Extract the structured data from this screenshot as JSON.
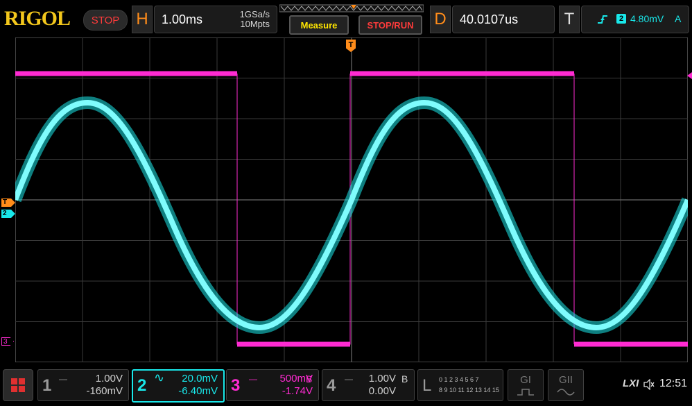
{
  "topbar": {
    "brand": "RIGOL",
    "run_state": "STOP",
    "horizontal": {
      "letter": "H",
      "timebase": "1.00ms",
      "sample_rate": "1GSa/s",
      "memory_depth": "10Mpts"
    },
    "measure_label": "Measure",
    "stoprun_label": "STOP/RUN",
    "delay": {
      "letter": "D",
      "value": "40.0107us"
    },
    "trigger": {
      "letter": "T",
      "source": "2",
      "level": "4.80mV",
      "mode": "A"
    }
  },
  "markers": {
    "trigger_top": "T",
    "trigger_left": "T",
    "ch2_left": "2",
    "ch3_left": "3"
  },
  "channels": [
    {
      "num": "1",
      "scale": "1.00V",
      "offset": "-160mV",
      "coupling_icon": "dc-coupling-icon",
      "color": "#9a9a9a",
      "extra": ""
    },
    {
      "num": "2",
      "scale": "20.0mV",
      "offset": "-6.40mV",
      "coupling_icon": "ac-coupling-icon",
      "color": "#19e8ea",
      "extra": ""
    },
    {
      "num": "3",
      "scale": "500mV",
      "offset": "-1.74V",
      "coupling_icon": "dc-coupling-icon",
      "color": "#ff2bd2",
      "extra": "B"
    },
    {
      "num": "4",
      "scale": "1.00V",
      "offset": "0.00V",
      "coupling_icon": "dc-coupling-icon",
      "color": "#9a9a9a",
      "extra": "B"
    }
  ],
  "logic": {
    "letter": "L",
    "row1": "0 1 2 3  4 5 6 7",
    "row2": "8 9 10 11 12 13 14 15"
  },
  "generators": [
    {
      "label": "GI"
    },
    {
      "label": "GII"
    }
  ],
  "status": {
    "lxi": "LXI",
    "time": "12:51"
  },
  "colors": {
    "ch2": "#19e8ea",
    "ch3": "#ff2bd2",
    "accent": "#ff8c1a",
    "brand": "#f3c71c"
  }
}
